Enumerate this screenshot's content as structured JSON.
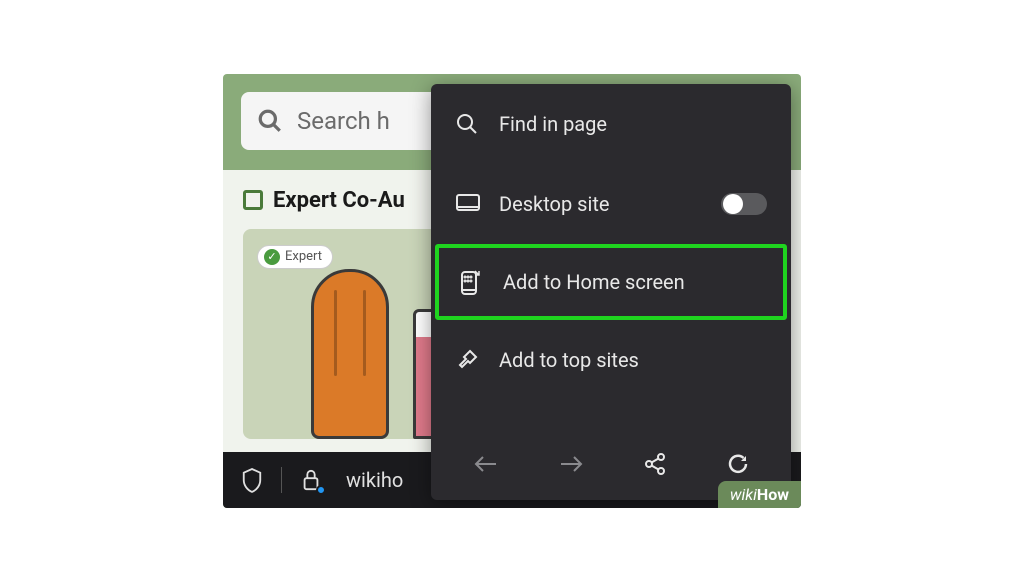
{
  "search": {
    "placeholder": "Search h"
  },
  "section": {
    "title": "Expert Co-Au"
  },
  "badge": {
    "label": "Expert"
  },
  "url": {
    "text": "wikiho"
  },
  "menu": {
    "find": "Find in page",
    "desktop": "Desktop site",
    "home": "Add to Home screen",
    "topsites": "Add to top sites"
  },
  "watermark": {
    "prefix": "wiki",
    "suffix": "How"
  }
}
